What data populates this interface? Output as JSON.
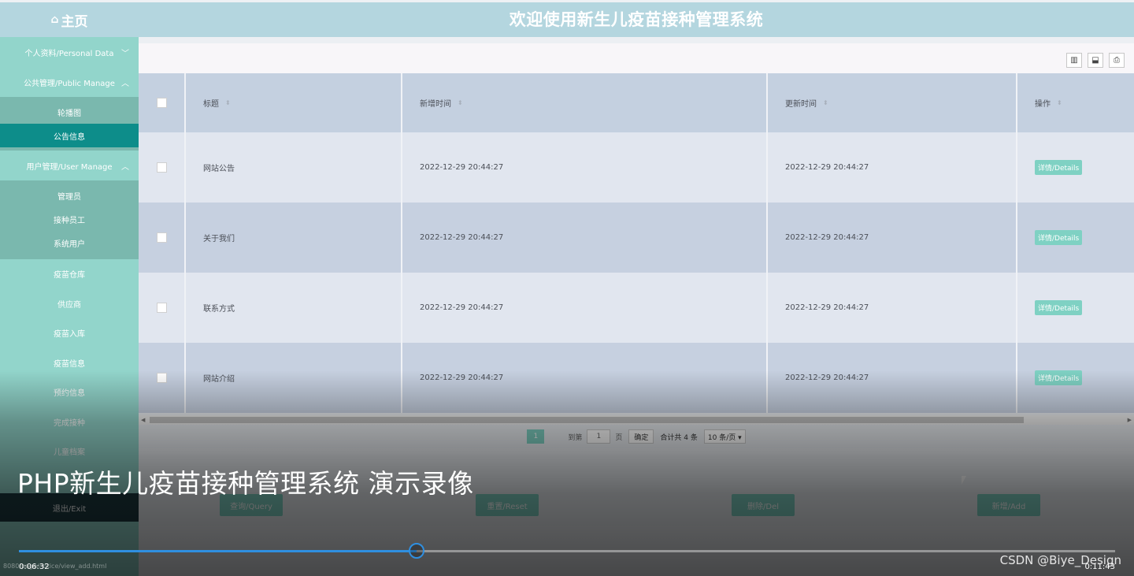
{
  "header": {
    "home_label": "主页",
    "home_icon": "home-icon",
    "title": "欢迎使用新生儿疫苗接种管理系统"
  },
  "sidebar": {
    "personal": "个人资料/Personal Data",
    "public_manage": "公共管理/Public Manage",
    "public_items": [
      "轮播图",
      "公告信息"
    ],
    "user_manage": "用户管理/User Manage",
    "user_items": [
      "管理员",
      "接种员工",
      "系统用户"
    ],
    "items": [
      "疫苗仓库",
      "供应商",
      "疫苗入库",
      "疫苗信息",
      "预约信息",
      "完成接种",
      "儿童档案"
    ],
    "logout": "退出/Exit"
  },
  "toolbar": {
    "icons": [
      "columns-icon",
      "export-icon",
      "print-icon"
    ]
  },
  "table": {
    "headers": [
      "标题",
      "新增时间",
      "更新时间",
      "操作"
    ],
    "detail_label": "详情/Details",
    "rows": [
      {
        "title": "网站公告",
        "created": "2022-12-29 20:44:27",
        "updated": "2022-12-29 20:44:27"
      },
      {
        "title": "关于我们",
        "created": "2022-12-29 20:44:27",
        "updated": "2022-12-29 20:44:27"
      },
      {
        "title": "联系方式",
        "created": "2022-12-29 20:44:27",
        "updated": "2022-12-29 20:44:27"
      },
      {
        "title": "网站介绍",
        "created": "2022-12-29 20:44:27",
        "updated": "2022-12-29 20:44:27"
      }
    ]
  },
  "pager": {
    "current_page": "1",
    "goto_label": "到第",
    "goto_value": "1",
    "page_suffix": "页",
    "confirm": "确定",
    "total": "合计共 4 条",
    "per_page": "10 条/页 ▾"
  },
  "actions": {
    "query": "查询/Query",
    "reset": "重置/Reset",
    "delete": "删除/Del",
    "add": "新增/Add"
  },
  "player": {
    "video_title": "PHP新生儿疫苗接种管理系统 演示录像",
    "current_time": "0:06:32",
    "total_time": "0:11:43",
    "progress": 0.3625,
    "watermark": "CSDN @Biye_Design",
    "status_url": "8080/page/notice/view_add.html"
  },
  "colors": {
    "accent": "#7fd1c3",
    "sidebar": "#92d5cb",
    "active": "#0d8d8a",
    "header": "#b4d6df",
    "progress": "#2f8fe0"
  }
}
